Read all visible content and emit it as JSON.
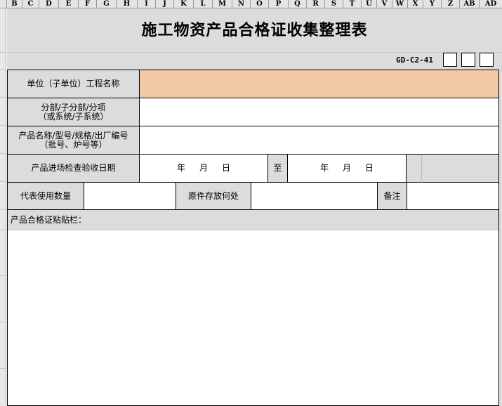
{
  "spreadsheet": {
    "columns": [
      "B",
      "C",
      "D",
      "E",
      "F",
      "G",
      "H",
      "I",
      "J",
      "K",
      "L",
      "M",
      "N",
      "O",
      "P",
      "Q",
      "R",
      "S",
      "T",
      "U",
      "V",
      "W",
      "X",
      "Y",
      "Z",
      "AB",
      "AD"
    ]
  },
  "form": {
    "title": "施工物资产品合格证收集整理表",
    "code": "GD-C2-41",
    "rows": {
      "project_name_label": "单位（子单位）工程名称",
      "division_label_line1": "分部/子分部/分项",
      "division_label_line2": "（或系统/子系统）",
      "product_label_line1": "产品名称/型号/规格/出厂编号",
      "product_label_line2": "（批号、炉号等）",
      "inspection_date_label": "产品进场检查验收日期",
      "date_year": "年",
      "date_month": "月",
      "date_day": "日",
      "date_to": "至",
      "quantity_label": "代表使用数量",
      "storage_label": "原件存放何处",
      "remarks_label": "备注",
      "paste_label": "产品合格证粘贴栏："
    }
  }
}
